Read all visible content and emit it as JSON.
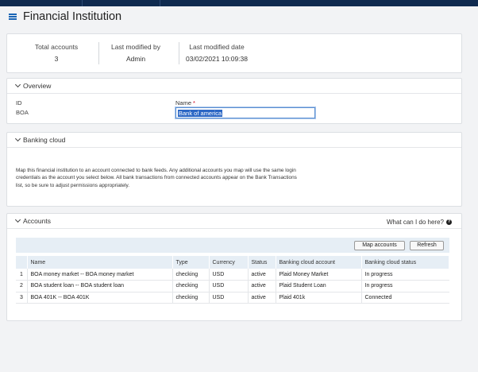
{
  "page": {
    "title": "Financial Institution"
  },
  "summary": [
    {
      "label": "Total accounts",
      "value": "3"
    },
    {
      "label": "Last modified by",
      "value": "Admin"
    },
    {
      "label": "Last modified date",
      "value": "03/02/2021 10:09:38"
    }
  ],
  "overview": {
    "title": "Overview",
    "id_label": "ID",
    "id_value": "BOA",
    "name_label": "Name",
    "name_required": "*",
    "name_value": "Bank of america"
  },
  "banking_cloud": {
    "title": "Banking cloud",
    "description": "Map this financial institution to an account connected to bank feeds. Any additional accounts you map will use the same login credentials as the account you select below. All bank transactions from connected accounts appear on the Bank Transactions list, so be sure to adjust permissions appropriately."
  },
  "accounts": {
    "title": "Accounts",
    "help_text": "What can I do here?",
    "map_button": "Map accounts",
    "refresh_button": "Refresh",
    "columns": [
      "",
      "Name",
      "Type",
      "Currency",
      "Status",
      "Banking cloud account",
      "Banking cloud status"
    ],
    "rows": [
      [
        "1",
        "BOA money market -- BOA money market",
        "checking",
        "USD",
        "active",
        "Plaid Money Market",
        "In progress"
      ],
      [
        "2",
        "BOA student loan -- BOA student loan",
        "checking",
        "USD",
        "active",
        "Plaid Student Loan",
        "In progress"
      ],
      [
        "3",
        "BOA 401K -- BOA 401K",
        "checking",
        "USD",
        "active",
        "Plaid 401k",
        "Connected"
      ]
    ]
  }
}
